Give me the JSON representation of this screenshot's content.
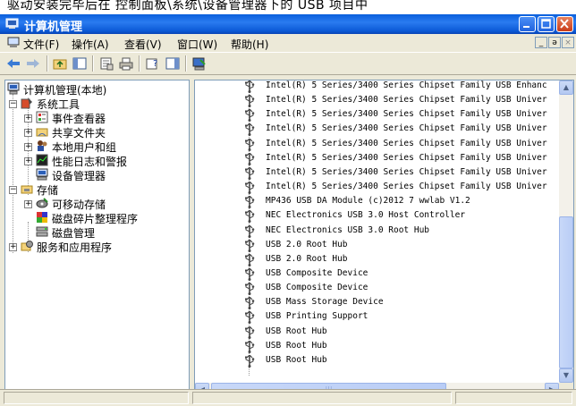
{
  "background_caption": "驱动安装完毕后在 控制面板\\系统\\设备管理器下的 USB 项目中",
  "window": {
    "title": "计算机管理",
    "colors": {
      "titlebar": "#0a5fdc",
      "close": "#c93b18",
      "panel_border": "#7f9db9",
      "face": "#ece9d8"
    }
  },
  "menu": {
    "items": [
      {
        "label": "文件(F)",
        "icon": "none"
      },
      {
        "label": "操作(A)"
      },
      {
        "label": "查看(V)"
      },
      {
        "label": "窗口(W)"
      },
      {
        "label": "帮助(H)"
      }
    ],
    "mdi": {
      "minimize": "_",
      "restore": "ə",
      "close": "×"
    }
  },
  "toolbar": {
    "icons": [
      "back-icon",
      "forward-icon",
      "up-icon",
      "show-hide-tree-icon",
      "properties-icon",
      "print-icon",
      "help-icon",
      "show-hide-action-pane-icon",
      "computer-icon"
    ]
  },
  "tree": {
    "root": "计算机管理(本地)",
    "system_tools": "系统工具",
    "event_viewer": "事件查看器",
    "shared_folders": "共享文件夹",
    "local_users": "本地用户和组",
    "perf_logs": "性能日志和警报",
    "device_manager": "设备管理器",
    "storage": "存储",
    "removable": "可移动存储",
    "defrag": "磁盘碎片整理程序",
    "disk_mgmt": "磁盘管理",
    "services": "服务和应用程序"
  },
  "devices": [
    "Intel(R) 5 Series/3400 Series Chipset Family USB Enhanc",
    "Intel(R) 5 Series/3400 Series Chipset Family USB Univer",
    "Intel(R) 5 Series/3400 Series Chipset Family USB Univer",
    "Intel(R) 5 Series/3400 Series Chipset Family USB Univer",
    "Intel(R) 5 Series/3400 Series Chipset Family USB Univer",
    "Intel(R) 5 Series/3400 Series Chipset Family USB Univer",
    "Intel(R) 5 Series/3400 Series Chipset Family USB Univer",
    "Intel(R) 5 Series/3400 Series Chipset Family USB Univer",
    "MP436 USB DA Module (c)2012 7  wwlab V1.2",
    "NEC Electronics USB 3.0 Host Controller",
    "NEC Electronics USB 3.0 Root Hub",
    "USB 2.0 Root Hub",
    "USB 2.0 Root Hub",
    "USB Composite Device",
    "USB Composite Device",
    "USB Mass Storage Device",
    "USB Printing Support",
    "USB Root Hub",
    "USB Root Hub",
    "USB Root Hub"
  ],
  "scroll": {
    "up": "▲",
    "down": "▼",
    "left": "◀",
    "right": "▶",
    "grip": "|||"
  }
}
